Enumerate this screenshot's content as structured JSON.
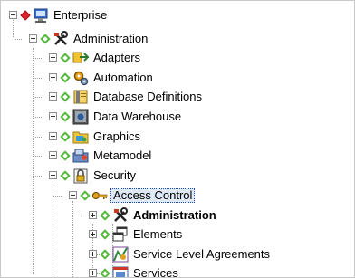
{
  "colors": {
    "root_marker": "#e0242c",
    "node_marker": "#52b83a",
    "selection_bg": "#dfe9f7"
  },
  "tree": {
    "root": {
      "label": "Enterprise",
      "icon": "enterprise-server-icon",
      "expanded": true
    },
    "administration": {
      "label": "Administration",
      "icon": "tools-icon",
      "expanded": true
    },
    "adapters": {
      "label": "Adapters",
      "icon": "adapters-icon",
      "expanded": false
    },
    "automation": {
      "label": "Automation",
      "icon": "automation-gears-icon",
      "expanded": false
    },
    "database_definitions": {
      "label": "Database Definitions",
      "icon": "database-icon",
      "expanded": false
    },
    "data_warehouse": {
      "label": "Data Warehouse",
      "icon": "data-warehouse-icon",
      "expanded": false
    },
    "graphics": {
      "label": "Graphics",
      "icon": "graphics-folder-icon",
      "expanded": false
    },
    "metamodel": {
      "label": "Metamodel",
      "icon": "metamodel-icon",
      "expanded": false
    },
    "security": {
      "label": "Security",
      "icon": "security-lock-icon",
      "expanded": true
    },
    "access_control": {
      "label": "Access Control",
      "icon": "key-icon",
      "expanded": true,
      "selected": true
    },
    "ac_administration": {
      "label": "Administration",
      "icon": "tools-icon",
      "expanded": false
    },
    "elements": {
      "label": "Elements",
      "icon": "elements-windows-icon",
      "expanded": false
    },
    "sla": {
      "label": "Service Level Agreements",
      "icon": "service-level-agreement-icon",
      "expanded": false
    },
    "services": {
      "label": "Services",
      "icon": "services-icon",
      "expanded": false
    }
  }
}
